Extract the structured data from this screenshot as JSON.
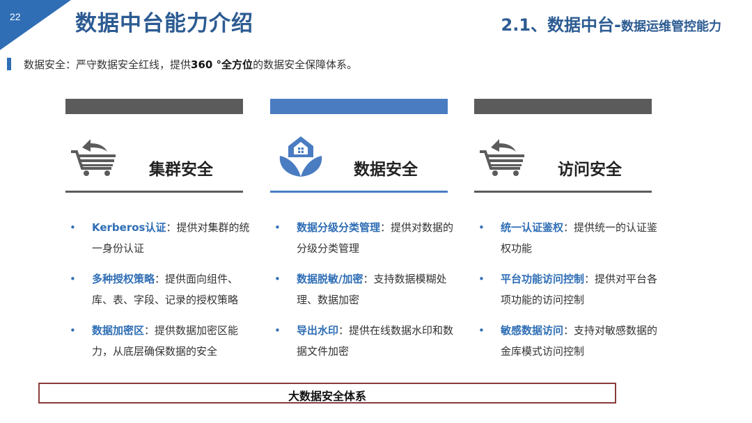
{
  "slide": {
    "page_number": "22",
    "title": "数据中台能力介绍",
    "subtitle_main": "2.1、数据中台-",
    "subtitle_small": "数据运维管控能力",
    "intro_prefix": "数据安全：严守数据安全红线，提供",
    "intro_bold": "360 °全方位",
    "intro_suffix": "的数据安全保障体系。",
    "footer": "大数据安全体系"
  },
  "columns": [
    {
      "title": "集群安全",
      "icon": "shopping-cart-icon",
      "accent": "#5b5b5b",
      "items": [
        {
          "keyword": "Kerberos认证",
          "text": "：提供对集群的统一身份认证"
        },
        {
          "keyword": "多种授权策略",
          "text": "：提供面向组件、库、表、字段、记录的授权策略"
        },
        {
          "keyword": "数据加密区",
          "text": "：提供数据加密区能力，从底层确保数据的安全"
        }
      ]
    },
    {
      "title": "数据安全",
      "icon": "shield-leaf-icon",
      "accent": "#4a7cc1",
      "items": [
        {
          "keyword": "数据分级分类管理",
          "text": "：提供对数据的分级分类管理"
        },
        {
          "keyword": "数据脱敏/加密",
          "text": "：支持数据模糊处理、数据加密"
        },
        {
          "keyword": "导出水印",
          "text": "：提供在线数据水印和数据文件加密"
        }
      ]
    },
    {
      "title": "访问安全",
      "icon": "shopping-cart-icon",
      "accent": "#5b5b5b",
      "items": [
        {
          "keyword": "统一认证鉴权",
          "text": "：提供统一的认证鉴权功能"
        },
        {
          "keyword": "平台功能访问控制",
          "text": "：提供对平台各项功能的访问控制"
        },
        {
          "keyword": "敏感数据访问",
          "text": "：支持对敏感数据的金库模式访问控制"
        }
      ]
    }
  ],
  "colors": {
    "brand_blue": "#2f6eb5",
    "title_blue": "#2c5b92",
    "gray": "#5b5b5b",
    "footer_border": "#8b3a3a"
  }
}
